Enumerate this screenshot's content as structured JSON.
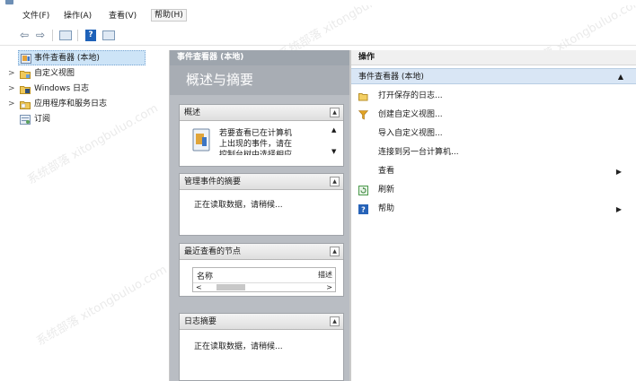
{
  "menu": {
    "items": [
      {
        "label": "文件(F)"
      },
      {
        "label": "操作(A)"
      },
      {
        "label": "查看(V)"
      },
      {
        "label": "帮助(H)"
      }
    ]
  },
  "toolbar": {
    "back": "⇦",
    "forward": "⇨",
    "help": "?"
  },
  "tree": {
    "root": "事件查看器 (本地)",
    "items": [
      {
        "label": "自定义视图",
        "expandable": true
      },
      {
        "label": "Windows 日志",
        "expandable": true
      },
      {
        "label": "应用程序和服务日志",
        "expandable": true
      },
      {
        "label": "订阅",
        "expandable": false
      }
    ]
  },
  "center": {
    "header": "事件查看器 (本地)",
    "banner": "概述与摘要",
    "overview": {
      "title": "概述",
      "text": [
        "若要查看已在计算机",
        "上出现的事件，请在",
        "控制台树中选择相应"
      ]
    },
    "admin_events": {
      "title": "管理事件的摘要",
      "status": "正在读取数据，请稍候..."
    },
    "recent_nodes": {
      "title": "最近查看的节点",
      "columns": [
        "名称",
        "描述"
      ]
    },
    "log_summary": {
      "title": "日志摘要",
      "status": "正在读取数据，请稍候..."
    }
  },
  "actions": {
    "header": "操作",
    "group": "事件查看器 (本地)",
    "items": [
      {
        "label": "打开保存的日志...",
        "icon": "folder-open-icon"
      },
      {
        "label": "创建自定义视图...",
        "icon": "filter-icon"
      },
      {
        "label": "导入自定义视图...",
        "icon": ""
      },
      {
        "label": "连接到另一台计算机...",
        "icon": ""
      },
      {
        "label": "查看",
        "icon": "",
        "submenu": true
      },
      {
        "label": "刷新",
        "icon": "refresh-icon"
      },
      {
        "label": "帮助",
        "icon": "help-icon",
        "submenu": true
      }
    ]
  },
  "colors": {
    "center_bg": "#b9bdc3",
    "selection": "#cde4f7",
    "group_bg": "#d9e6f5",
    "accent_blue": "#1e62b9"
  }
}
